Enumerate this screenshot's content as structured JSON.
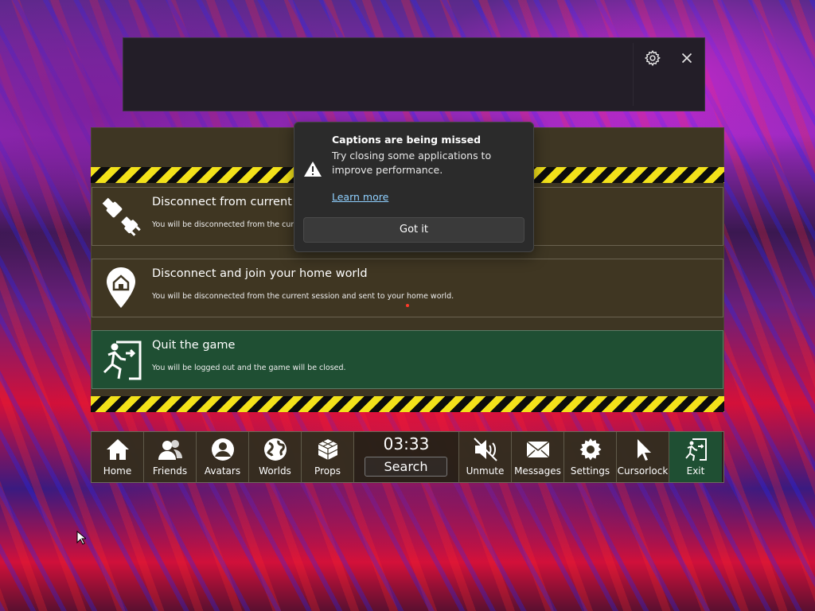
{
  "caption_bar": {
    "settings_icon": "gear-icon",
    "close_icon": "close-icon"
  },
  "toast": {
    "icon": "warning-icon",
    "title": "Captions are being missed",
    "body": "Try closing some applications to improve performance.",
    "link": "Learn more",
    "button": "Got it"
  },
  "exit_menu": {
    "options": [
      {
        "icon": "unplug-icon",
        "title": "Disconnect from current Se",
        "desc": "You will be disconnected from the curre"
      },
      {
        "icon": "home-pin-icon",
        "title": "Disconnect and join your home world",
        "desc": "You will be disconnected from the current session and sent to your home world."
      },
      {
        "icon": "exit-door-icon",
        "title": "Quit the game",
        "desc": "You will be logged out and the game will be closed."
      }
    ]
  },
  "menubar": {
    "left": [
      {
        "label": "Home",
        "icon": "home-icon"
      },
      {
        "label": "Friends",
        "icon": "friends-icon"
      },
      {
        "label": "Avatars",
        "icon": "avatar-icon"
      },
      {
        "label": "Worlds",
        "icon": "globe-icon"
      },
      {
        "label": "Props",
        "icon": "cube-icon"
      }
    ],
    "center": {
      "clock": "03:33",
      "search": "Search"
    },
    "right": [
      {
        "label": "Unmute",
        "icon": "speaker-muted-icon"
      },
      {
        "label": "Messages",
        "icon": "envelope-icon"
      },
      {
        "label": "Settings",
        "icon": "gear-icon"
      },
      {
        "label": "Cursorlock",
        "icon": "cursor-icon"
      },
      {
        "label": "Exit",
        "icon": "exit-icon"
      }
    ]
  },
  "colors": {
    "hazard_yellow": "#f3e21a",
    "panel_brown": "#3e3623",
    "exit_green": "#1f4f33",
    "link_blue": "#8fd0ff"
  }
}
